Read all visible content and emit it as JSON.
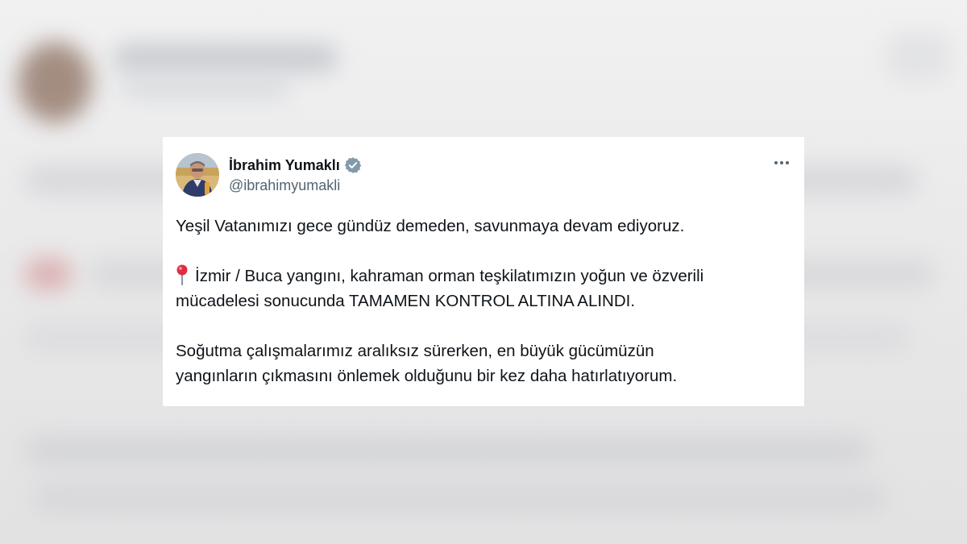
{
  "tweet": {
    "display_name": "İbrahim Yumaklı",
    "handle": "@ibrahimyumakli",
    "verified": true,
    "paragraphs": [
      "Yeşil Vatanımızı gece gündüz demeden, savunmaya devam ediyoruz.",
      "İzmir / Buca yangını, kahraman orman teşkilatımızın yoğun ve özverili",
      "mücadelesi sonucunda TAMAMEN KONTROL ALTINA ALINDI.",
      "Soğutma çalışmalarımız aralıksız sürerken, en büyük gücümüzün",
      "yangınların çıkmasını önlemek olduğunu bir kez daha hatırlatıyorum."
    ],
    "pin_icon": "round-pushpin-icon"
  },
  "colors": {
    "text_primary": "#0f1419",
    "text_secondary": "#536471",
    "verified_badge": "#829aab",
    "pin_red": "#dd2e44"
  }
}
